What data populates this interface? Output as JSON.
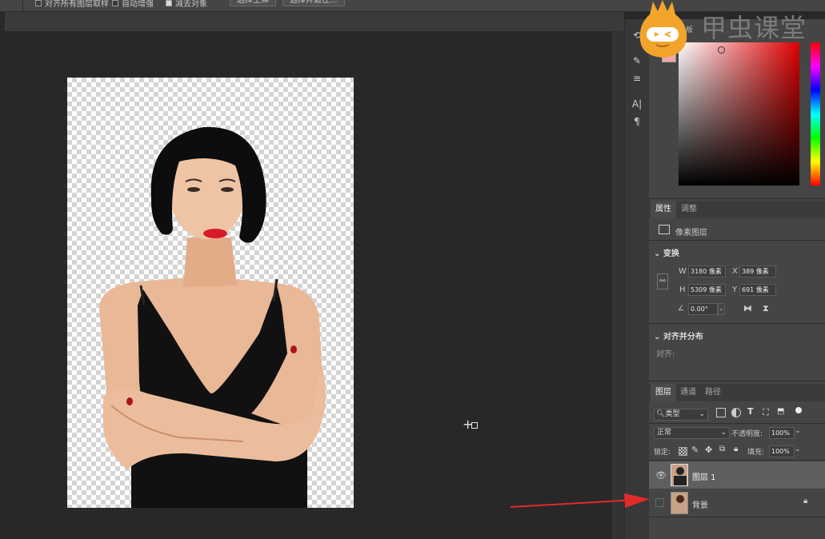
{
  "options_bar": {
    "checkbox1_label": "对齐所有图层取样",
    "checkbox2_label": "自动增强",
    "checkbox3_label": "减去对象",
    "button_select_subject": "选择主体",
    "button_select_and_mask": "选择并遮住..."
  },
  "logo": {
    "text": "甲虫课堂"
  },
  "color_panel": {
    "tab_visible": "板",
    "foreground_color": "#f2a6a4"
  },
  "properties_panel": {
    "tabs": [
      "属性",
      "调整"
    ],
    "active_tab": "属性",
    "layer_type": "像素图层",
    "transform_header": "变换",
    "w_label": "W",
    "w_value": "3180 像素",
    "x_label": "X",
    "x_value": "389 像素",
    "h_label": "H",
    "h_value": "5309 像素",
    "y_label": "Y",
    "y_value": "691 像素",
    "angle_value": "0.00°",
    "align_header": "对齐并分布",
    "align_label": "对齐:"
  },
  "layers_panel": {
    "tabs": [
      "图层",
      "通道",
      "路径"
    ],
    "active_tab": "图层",
    "filter_kind": "类型",
    "blend_mode": "正常",
    "opacity_label": "不透明度:",
    "opacity_value": "100%",
    "lock_label": "锁定:",
    "fill_label": "填充:",
    "fill_value": "100%",
    "layers": [
      {
        "name": "图层 1",
        "visible": true,
        "selected": true,
        "locked": false
      },
      {
        "name": "背景",
        "visible": false,
        "selected": false,
        "locked": true
      }
    ]
  },
  "annotation": {
    "arrow_color": "#e02a2a"
  }
}
